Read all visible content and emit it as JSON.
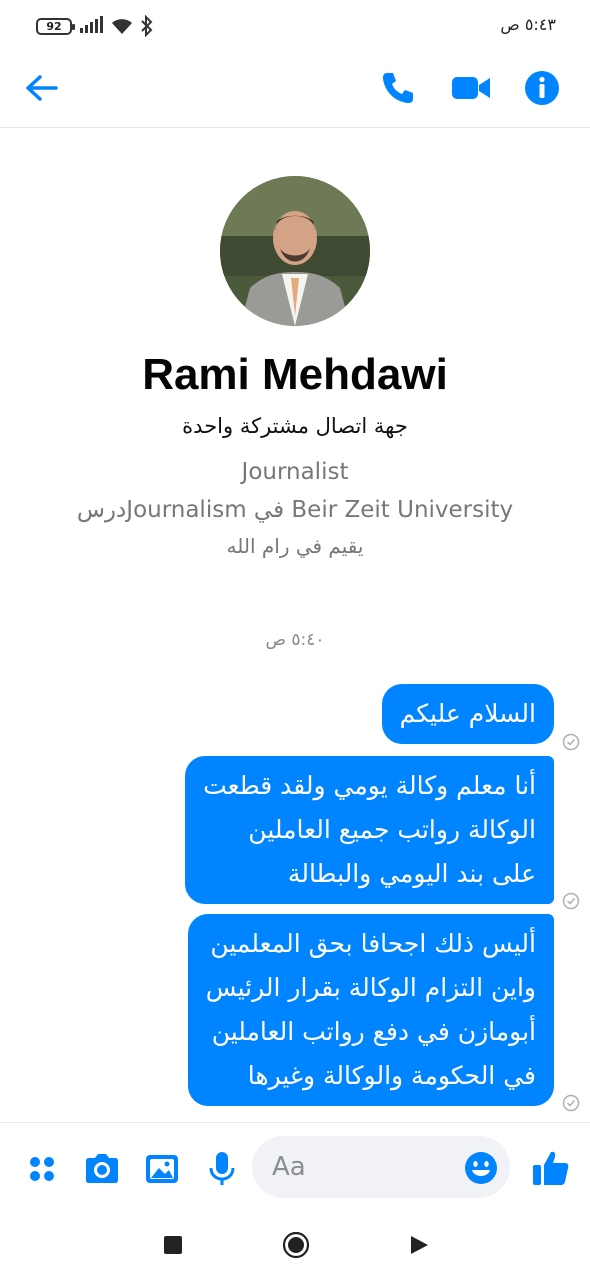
{
  "status_bar": {
    "time": "٥:٤٣ ص",
    "battery": "92"
  },
  "profile": {
    "name": "Rami Mehdawi",
    "mutual_contact": "جهة اتصال مشتركة واحدة",
    "job": "Journalist",
    "studied": "درسJournalism في Beir Zeit University",
    "lives": "يقيم في رام الله"
  },
  "conversation": {
    "timestamp": "٥:٤٠ ص",
    "messages": [
      {
        "text": "السلام عليكم"
      },
      {
        "text": "أنا معلم وكالة يومي ولقد قطعت\nالوكالة رواتب جميع العاملين\nعلى بند اليومي والبطالة"
      },
      {
        "text": "أليس ذلك اجحافا بحق المعلمين\nواين التزام الوكالة بقرار الرئيس\nأبومازن في دفع رواتب العاملين\nفي الحكومة والوكالة وغيرها"
      }
    ]
  },
  "composer": {
    "placeholder": "Aa"
  },
  "colors": {
    "accent": "#0084ff",
    "bubble_text": "#ffffff"
  },
  "icons": {
    "header": [
      "back-arrow-icon",
      "phone-icon",
      "video-camera-icon",
      "info-icon"
    ],
    "composer": [
      "menu-dots-icon",
      "camera-icon",
      "image-icon",
      "microphone-icon",
      "emoji-icon",
      "thumbs-up-icon"
    ],
    "nav": [
      "recents-square-icon",
      "home-circle-icon",
      "back-triangle-icon"
    ]
  }
}
